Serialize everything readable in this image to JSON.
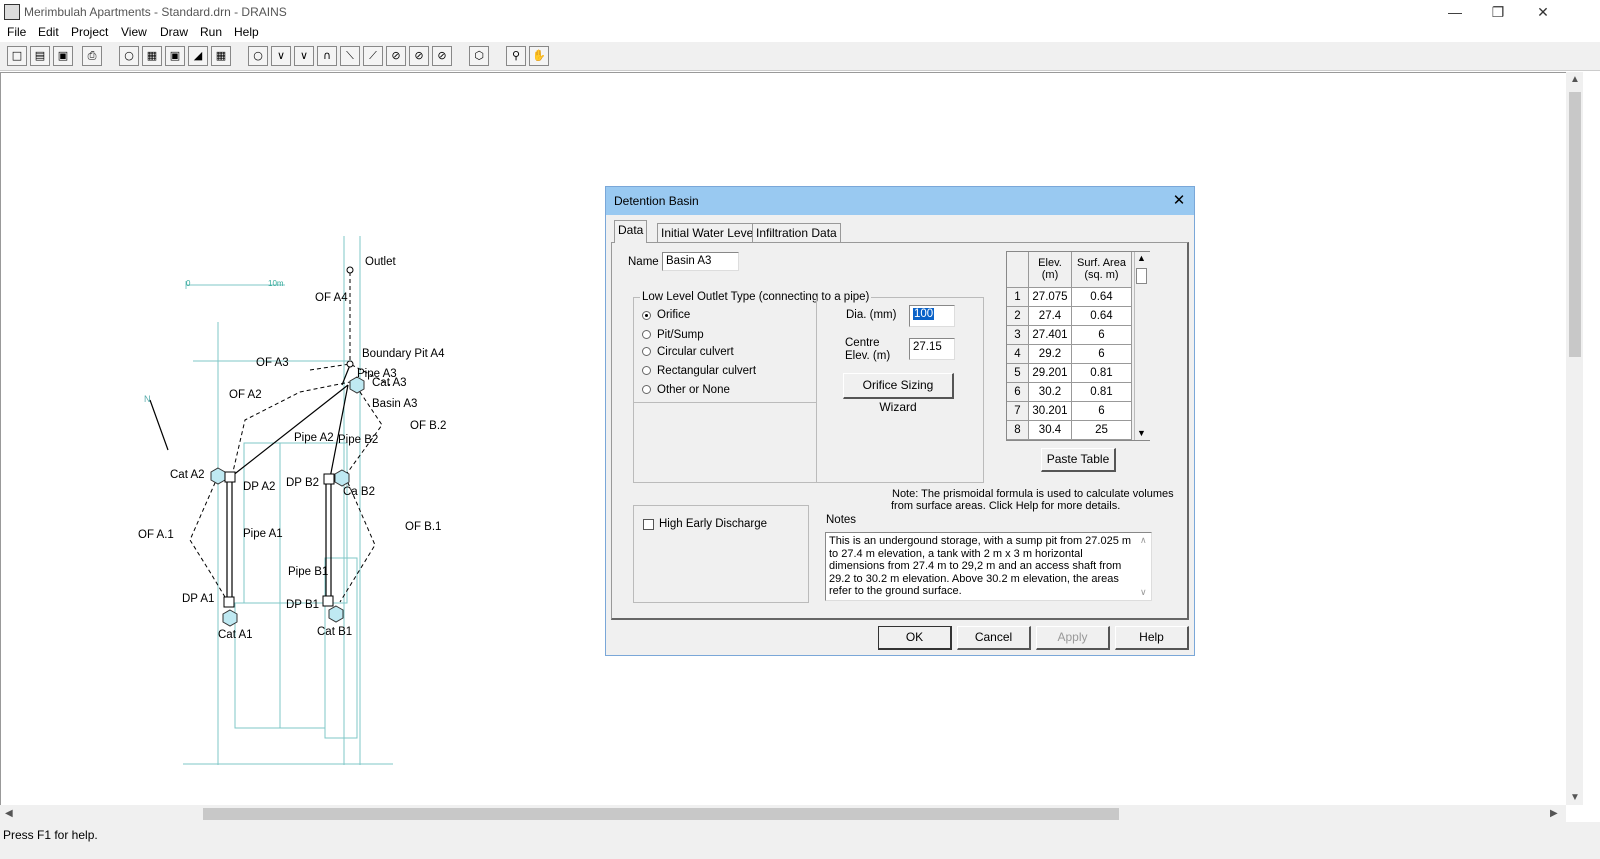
{
  "window": {
    "title": "Merimbulah Apartments - Standard.drn - DRAINS",
    "minimize_icon": "minimize-icon",
    "restore_icon": "restore-icon",
    "close_icon": "close-icon"
  },
  "menu": {
    "items": [
      "File",
      "Edit",
      "Project",
      "View",
      "Draw",
      "Run",
      "Help"
    ]
  },
  "drawing": {
    "scale_start": "0",
    "scale_end": "10m",
    "labels": {
      "outlet": "Outlet",
      "of_a4": "OF A4",
      "boundary_pit_a4": "Boundary Pit A4",
      "of_a3": "OF A3",
      "pipe_a3": "Pipe A3",
      "cat_a3": "Cat A3",
      "of_a2": "OF A2",
      "basin_a3": "Basin A3",
      "of_b2": "OF B.2",
      "pipe_a2": "Pipe A2",
      "pipe_b2": "Pipe B2",
      "cat_a2": "Cat A2",
      "dp_a2": "DP A2",
      "dp_b2": "DP B2",
      "ca_b2": "Ca B2",
      "of_a1": "OF A.1",
      "pipe_a1": "Pipe A1",
      "of_b1": "OF B.1",
      "pipe_b1": "Pipe B1",
      "dp_a1": "DP A1",
      "dp_b1": "DP B1",
      "cat_a1": "Cat A1",
      "cat_b1": "Cat B1",
      "north": "N"
    }
  },
  "status": {
    "text": "Press F1 for help."
  },
  "dialog": {
    "title": "Detention Basin",
    "tabs": [
      "Data",
      "Initial Water Level",
      "Infiltration Data"
    ],
    "active_tab": "Data",
    "name_label": "Name",
    "name_value": "Basin A3",
    "outlet_group_label": "Low Level Outlet Type (connecting to a pipe)",
    "outlet_options": [
      "Orifice",
      "Pit/Sump",
      "Circular culvert",
      "Rectangular culvert",
      "Other or None"
    ],
    "outlet_selected": "Orifice",
    "dia_label": "Dia. (mm)",
    "dia_value": "100",
    "centre_label_1": "Centre",
    "centre_label_2": "Elev. (m)",
    "centre_value": "27.15",
    "wizard_button": "Orifice Sizing Wizard",
    "table": {
      "col_elev_1": "Elev.",
      "col_elev_2": "(m)",
      "col_area_1": "Surf. Area",
      "col_area_2": "(sq. m)",
      "rows": [
        {
          "n": "1",
          "elev": "27.075",
          "area": "0.64"
        },
        {
          "n": "2",
          "elev": "27.4",
          "area": "0.64"
        },
        {
          "n": "3",
          "elev": "27.401",
          "area": "6"
        },
        {
          "n": "4",
          "elev": "29.2",
          "area": "6"
        },
        {
          "n": "5",
          "elev": "29.201",
          "area": "0.81"
        },
        {
          "n": "6",
          "elev": "30.2",
          "area": "0.81"
        },
        {
          "n": "7",
          "elev": "30.201",
          "area": "6"
        },
        {
          "n": "8",
          "elev": "30.4",
          "area": "25"
        }
      ]
    },
    "paste_button": "Paste Table",
    "note_line_1": "Note: The prismoidal formula is used to calculate volumes",
    "note_line_2": "from surface areas.  Click Help for more details.",
    "high_early_label": "High Early Discharge",
    "notes_label": "Notes",
    "notes_text": "This is an undergound storage, with a sump pit from 27.025 m to 27.4 m elevation, a tank with 2 m x 3 m horizontal dimensions from 27.4 m to 29,2 m and an access shaft from 29.2 to 30.2 m elevation.  Above 30.2 m elevation, the areas refer to the ground surface.",
    "buttons": {
      "ok": "OK",
      "cancel": "Cancel",
      "apply": "Apply",
      "help": "Help"
    }
  }
}
